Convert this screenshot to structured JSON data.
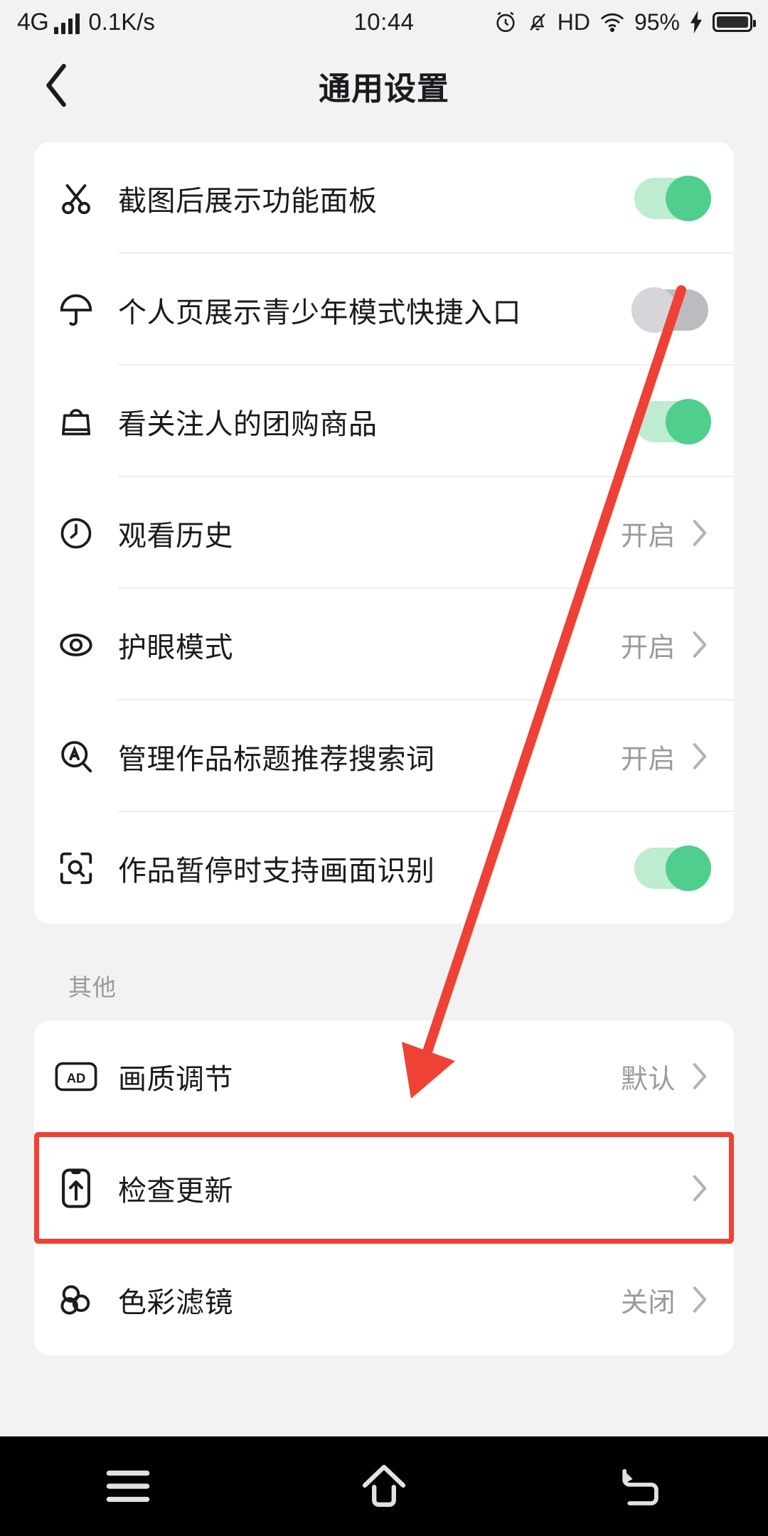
{
  "status_bar": {
    "network": "4G",
    "speed": "0.1K/s",
    "time": "10:44",
    "hd": "HD",
    "battery_percent": "95%",
    "icons": [
      "signal-bars-icon",
      "alarm-icon",
      "mute-icon",
      "hd-icon",
      "wifi-icon",
      "charging-icon",
      "battery-icon"
    ]
  },
  "header": {
    "title": "通用设置",
    "back_icon": "chevron-left-icon"
  },
  "main_section": {
    "rows": [
      {
        "icon": "scissors-icon",
        "label": "截图后展示功能面板",
        "control": "toggle",
        "toggle_state": "on",
        "value": ""
      },
      {
        "icon": "umbrella-icon",
        "label": "个人页展示青少年模式快捷入口",
        "control": "toggle",
        "toggle_state": "off",
        "value": ""
      },
      {
        "icon": "shopping-bag-icon",
        "label": "看关注人的团购商品",
        "control": "toggle",
        "toggle_state": "on",
        "value": ""
      },
      {
        "icon": "clock-icon",
        "label": "观看历史",
        "control": "value",
        "toggle_state": "",
        "value": "开启"
      },
      {
        "icon": "eye-icon",
        "label": "护眼模式",
        "control": "value",
        "toggle_state": "",
        "value": "开启"
      },
      {
        "icon": "search-a-icon",
        "label": "管理作品标题推荐搜索词",
        "control": "value",
        "toggle_state": "",
        "value": "开启"
      },
      {
        "icon": "scan-icon",
        "label": "作品暂停时支持画面识别",
        "control": "toggle",
        "toggle_state": "on",
        "value": ""
      }
    ]
  },
  "other_section": {
    "label": "其他",
    "rows": [
      {
        "icon": "ad-icon",
        "label": "画质调节",
        "control": "value",
        "value": "默认"
      },
      {
        "icon": "phone-update-icon",
        "label": "检查更新",
        "control": "chevron",
        "value": ""
      },
      {
        "icon": "color-filter-icon",
        "label": "色彩滤镜",
        "control": "value",
        "value": "关闭"
      }
    ]
  },
  "annotation": {
    "arrow_color": "#ef4136",
    "highlight_color": "#ef4136",
    "highlight_target": "检查更新",
    "arrow_from": "个人页展示青少年模式快捷入口 toggle",
    "arrow_to": "画质调节 row"
  },
  "navbar": {
    "recents_icon": "menu-icon",
    "home_icon": "home-icon",
    "back_icon": "back-return-icon"
  },
  "colors": {
    "page_bg": "#f2f2f2",
    "card_bg": "#ffffff",
    "text": "#1b1b1f",
    "muted_text": "#9a9a9e",
    "toggle_on": "#4fce8d",
    "toggle_on_track": "#bdecd0",
    "toggle_off": "#d6d6da",
    "toggle_off_track": "#bcbcc0",
    "accent_red": "#ef4136"
  }
}
